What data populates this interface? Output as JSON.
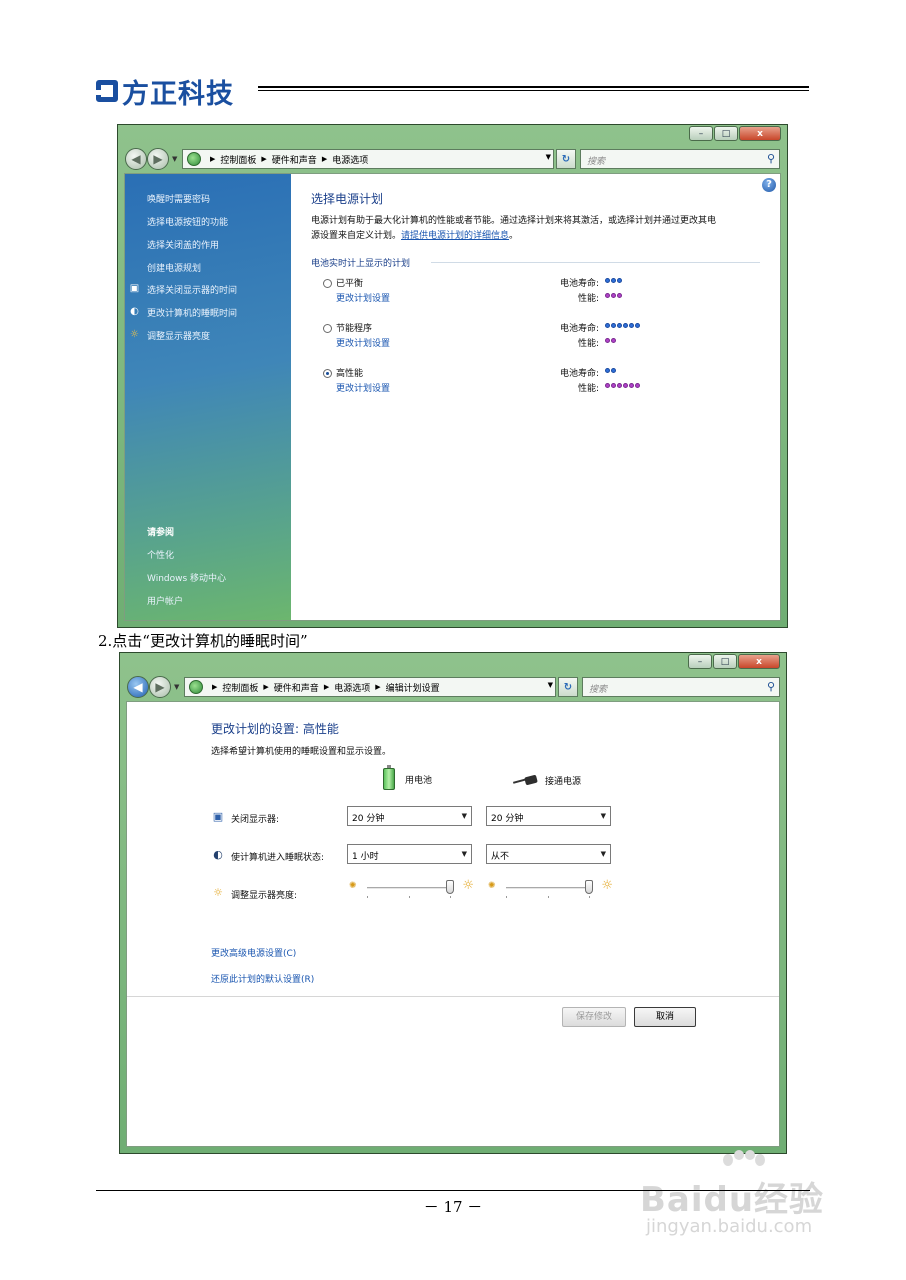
{
  "document": {
    "logo_text": "方正科技",
    "step_caption": "2.点击“更改计算机的睡眠时间”",
    "page_number": "－ 17 －"
  },
  "watermark": {
    "logo": "Baidu经验",
    "url": "jingyan.baidu.com"
  },
  "window1": {
    "title_controls": {
      "minimize": "–",
      "maximize": "□",
      "close": "x"
    },
    "breadcrumb": [
      "控制面板",
      "硬件和声音",
      "电源选项"
    ],
    "search_placeholder": "搜索",
    "sidebar": {
      "tasks": [
        "唤醒时需要密码",
        "选择电源按钮的功能",
        "选择关闭盖的作用",
        "创建电源规划",
        "选择关闭显示器的时间",
        "更改计算机的睡眠时间",
        "调整显示器亮度"
      ],
      "see_also_title": "请参阅",
      "see_also": [
        "个性化",
        "Windows 移动中心",
        "用户帐户"
      ]
    },
    "main": {
      "title": "选择电源计划",
      "desc_line1": "电源计划有助于最大化计算机的性能或者节能。通过选择计划来将其激活，或选择计划并通过更改其电",
      "desc_line2_prefix": "源设置来自定义计划。",
      "desc_link": "请提供电源计划的详细信息",
      "desc_suffix": "。",
      "group_label": "电池实时计上显示的计划",
      "battery_label": "电池寿命:",
      "performance_label": "性能:",
      "change_link": "更改计划设置",
      "plans": [
        {
          "name": "已平衡",
          "battery_life": 3,
          "performance": 3,
          "selected": false
        },
        {
          "name": "节能程序",
          "battery_life": 6,
          "performance": 2,
          "selected": false
        },
        {
          "name": "高性能",
          "battery_life": 2,
          "performance": 6,
          "selected": true
        }
      ]
    }
  },
  "window2": {
    "title_controls": {
      "minimize": "–",
      "maximize": "□",
      "close": "x"
    },
    "breadcrumb": [
      "控制面板",
      "硬件和声音",
      "电源选项",
      "编辑计划设置"
    ],
    "search_placeholder": "搜索",
    "title": "更改计划的设置: 高性能",
    "desc": "选择希望计算机使用的睡眠设置和显示设置。",
    "col_battery": "用电池",
    "col_plugged": "接通电源",
    "rows": {
      "display_off_label": "关闭显示器:",
      "display_off_battery": "20 分钟",
      "display_off_plugged": "20 分钟",
      "sleep_label": "使计算机进入睡眠状态:",
      "sleep_battery": "1 小时",
      "sleep_plugged": "从不",
      "brightness_label": "调整显示器亮度:",
      "brightness_battery_level": 1.0,
      "brightness_plugged_level": 1.0
    },
    "advanced_link": "更改高级电源设置(C)",
    "restore_link": "还原此计划的默认设置(R)",
    "save_button": "保存修改",
    "cancel_button": "取消"
  }
}
